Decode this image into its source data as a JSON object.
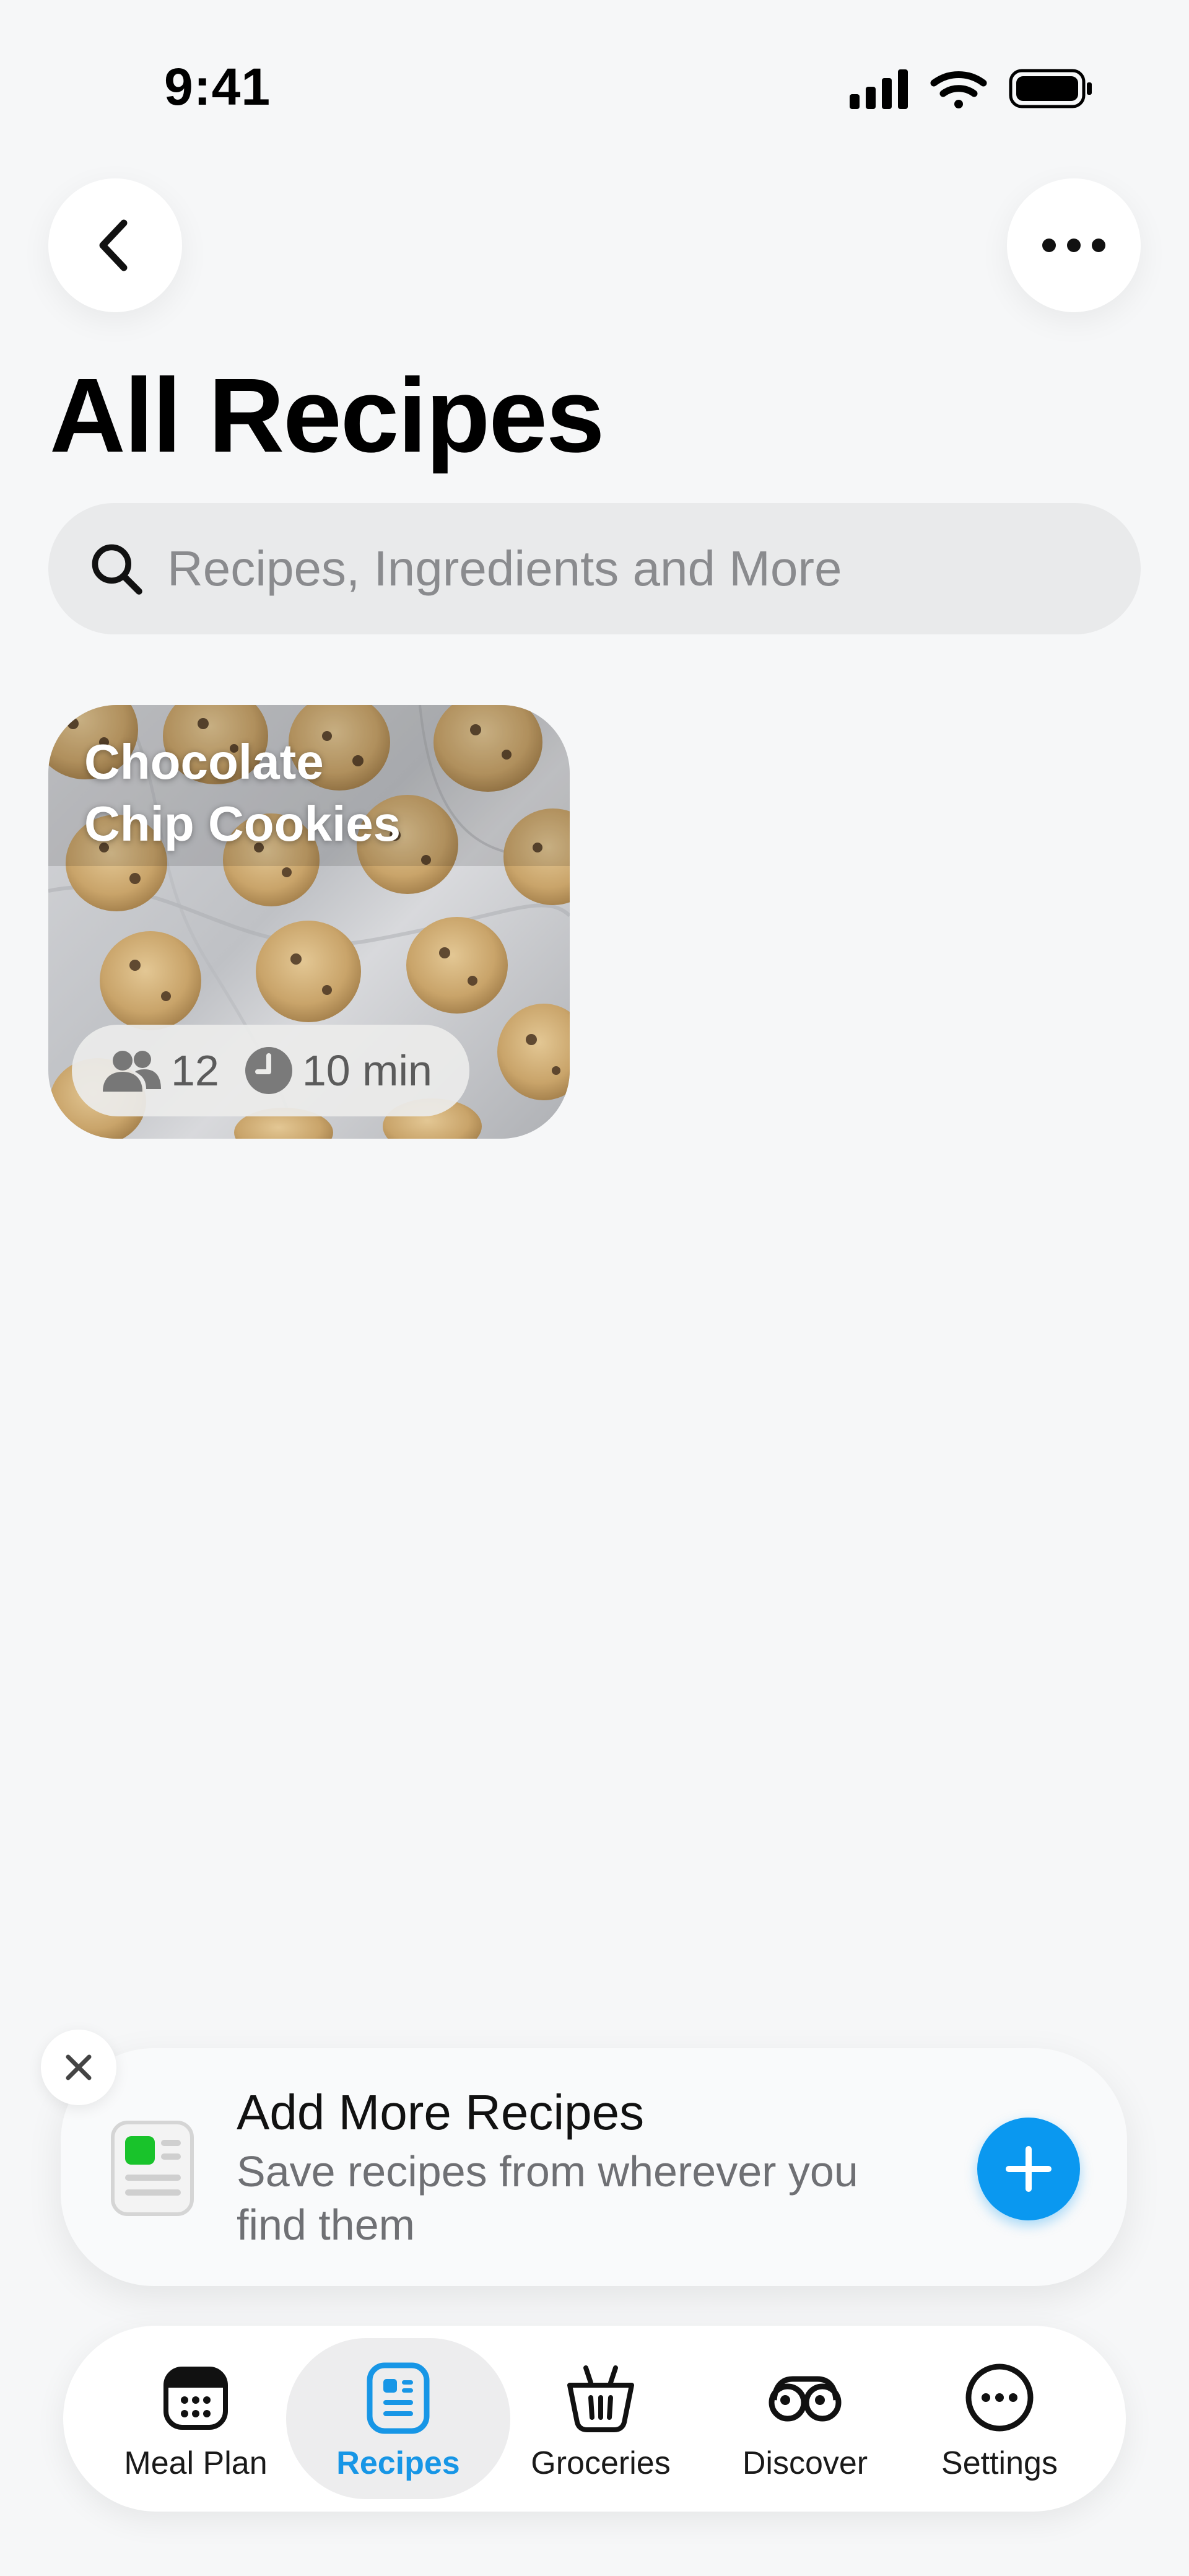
{
  "status_bar": {
    "time": "9:41"
  },
  "page": {
    "title": "All Recipes"
  },
  "search": {
    "placeholder": "Recipes, Ingredients and More"
  },
  "recipes": [
    {
      "title_line1": "Chocolate",
      "title_line2": "Chip Cookies",
      "servings": "12",
      "time": "10 min"
    }
  ],
  "banner": {
    "title": "Add More Recipes",
    "subtitle_line1": "Save recipes from wherever you",
    "subtitle_line2": "find them"
  },
  "tabs": [
    {
      "label": "Meal Plan",
      "icon": "calendar-icon"
    },
    {
      "label": "Recipes",
      "icon": "recipe-card-icon",
      "active": true
    },
    {
      "label": "Groceries",
      "icon": "basket-icon"
    },
    {
      "label": "Discover",
      "icon": "binoculars-icon"
    },
    {
      "label": "Settings",
      "icon": "ellipsis-circle-icon"
    }
  ],
  "colors": {
    "accent": "#0a98f0",
    "tab_active": "#1796e6",
    "background": "#f6f7f8"
  }
}
